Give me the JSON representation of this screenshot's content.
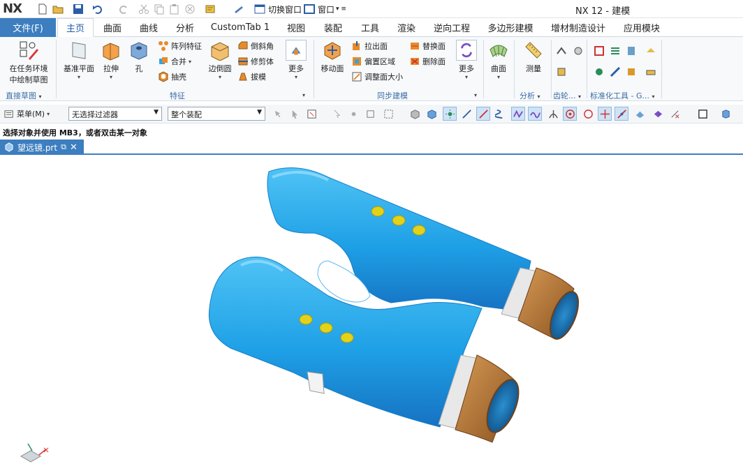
{
  "app": {
    "logo": "NX",
    "title": "NX 12 - 建模"
  },
  "quick_access": {
    "switch_window": "切换窗口",
    "window": "窗口"
  },
  "tabs": {
    "file": "文件(F)",
    "items": [
      "主页",
      "曲面",
      "曲线",
      "分析",
      "CustomTab 1",
      "视图",
      "装配",
      "工具",
      "渲染",
      "逆向工程",
      "多边形建模",
      "增材制造设计",
      "应用模块"
    ]
  },
  "ribbon": {
    "sketch": {
      "label_line1": "在任务环境",
      "label_line2": "中绘制草图",
      "group": "直接草图"
    },
    "feature": {
      "datum_plane": "基准平面",
      "extrude": "拉伸",
      "hole": "孔",
      "pattern": "阵列特征",
      "unite": "合并",
      "shell": "抽壳",
      "edge_blend": "边倒圆",
      "chamfer": "倒斜角",
      "trim_body": "修剪体",
      "draft": "拔模",
      "more": "更多",
      "group": "特征"
    },
    "sync": {
      "move_face": "移动面",
      "pull_face": "拉出面",
      "offset_region": "偏置区域",
      "resize_face": "调整面大小",
      "replace_face": "替换面",
      "delete_face": "删除面",
      "more": "更多",
      "group": "同步建模"
    },
    "surface": {
      "label": "曲面"
    },
    "analysis": {
      "measure": "测量",
      "group": "分析"
    },
    "gear": {
      "group": "齿轮..."
    },
    "standard": {
      "group": "标准化工具 - G..."
    }
  },
  "toolbar": {
    "menu": "菜单(M)",
    "filter": "无选择过滤器",
    "scope": "整个装配"
  },
  "status": {
    "message": "选择对象并使用 MB3，或者双击某一对象"
  },
  "document": {
    "tab_name": "望远镜.prt"
  },
  "colors": {
    "accent": "#3c7ebf",
    "body": "#2aa8e8",
    "cap": "#b87a3c",
    "dot": "#e3d21a"
  }
}
